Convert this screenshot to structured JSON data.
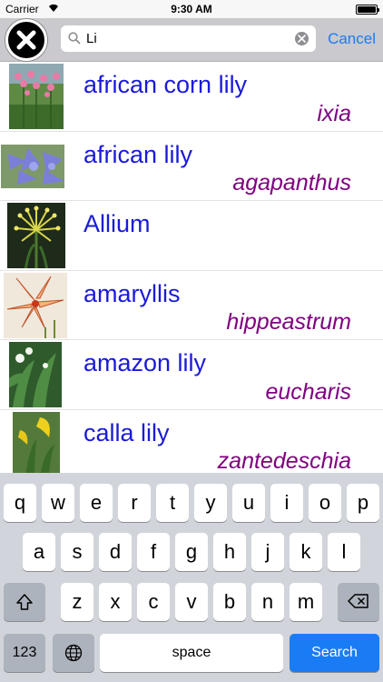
{
  "status_bar": {
    "carrier": "Carrier",
    "time": "9:30 AM"
  },
  "search": {
    "value": "Li",
    "cancel_label": "Cancel"
  },
  "results": [
    {
      "common": "african corn lily",
      "latin": "ixia",
      "thumb": "pink-flower"
    },
    {
      "common": "african lily",
      "latin": "agapanthus",
      "thumb": "blue-flower"
    },
    {
      "common": "Allium",
      "latin": "",
      "thumb": "yellow-allium"
    },
    {
      "common": "amaryllis",
      "latin": "hippeastrum",
      "thumb": "orange-lily"
    },
    {
      "common": "amazon lily",
      "latin": "eucharis",
      "thumb": "green-leaves"
    },
    {
      "common": "calla lily",
      "latin": "zantedeschia",
      "thumb": "yellow-calla"
    }
  ],
  "keyboard": {
    "row1": [
      "q",
      "w",
      "e",
      "r",
      "t",
      "y",
      "u",
      "i",
      "o",
      "p"
    ],
    "row2": [
      "a",
      "s",
      "d",
      "f",
      "g",
      "h",
      "j",
      "k",
      "l"
    ],
    "row3": [
      "z",
      "x",
      "c",
      "v",
      "b",
      "n",
      "m"
    ],
    "numbers_label": "123",
    "space_label": "space",
    "search_label": "Search"
  },
  "colors": {
    "common_name": "#1a1ad9",
    "latin_name": "#800080",
    "accent": "#1a7cf5"
  }
}
